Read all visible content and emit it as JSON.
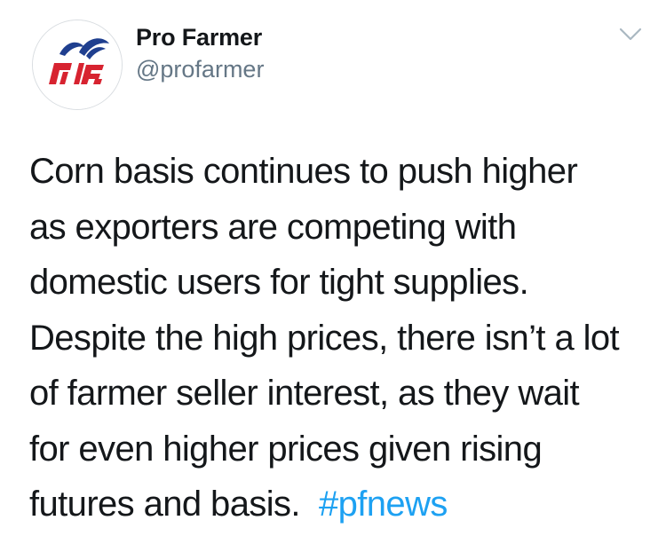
{
  "author": {
    "display_name": "Pro Farmer",
    "handle": "@profarmer",
    "avatar_letters": "PF"
  },
  "tweet": {
    "lines": [
      "Corn basis continues to push higher",
      "as exporters are competing with",
      "domestic users for tight supplies.",
      "Despite the high prices, there isn’t a lot",
      "of farmer seller interest, as they wait",
      "for even higher prices given rising",
      "futures and basis."
    ],
    "hashtag": "#pfnews"
  },
  "colors": {
    "hashtag": "#1da1f2",
    "handle": "#657786",
    "logo_red": "#d72330",
    "logo_blue": "#1f3f8f"
  },
  "icons": {
    "more": "chevron-down-icon"
  }
}
